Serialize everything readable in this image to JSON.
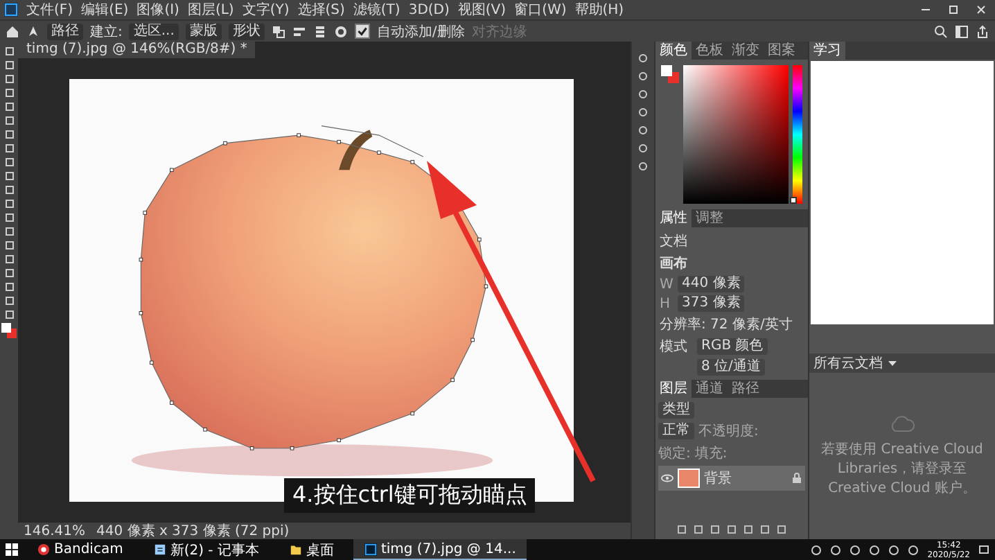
{
  "menu": [
    "文件(F)",
    "编辑(E)",
    "图像(I)",
    "图层(L)",
    "文字(Y)",
    "选择(S)",
    "滤镜(T)",
    "3D(D)",
    "视图(V)",
    "窗口(W)",
    "帮助(H)"
  ],
  "options_bar": {
    "mode": "路径",
    "make_label": "建立:",
    "make_button": "选区...",
    "mask_button": "蒙版",
    "shape_button": "形状",
    "auto_add_delete": {
      "label": "自动添加/删除",
      "checked": true
    },
    "align_edges": {
      "label": "对齐边缘",
      "disabled": true
    }
  },
  "document_tab": {
    "title": "timg (7).jpg @ 146%(RGB/8#) *"
  },
  "caption": "4.按住ctrl键可拖动瞄点",
  "color_panel": {
    "hue": {
      "level": 0
    },
    "tabs": [
      {
        "label": "颜色",
        "selected": true
      },
      {
        "label": "色板",
        "selected": false
      },
      {
        "label": "渐变",
        "selected": false
      },
      {
        "label": "图案",
        "selected": false
      }
    ]
  },
  "learn_panel": {
    "tabs": [
      {
        "label": "学习",
        "selected": true
      }
    ]
  },
  "properties_panel": {
    "tabs": [
      {
        "label": "属性",
        "selected": true
      },
      {
        "label": "调整",
        "selected": false
      }
    ],
    "section": "文档",
    "group": "画布",
    "width_label": "W",
    "width": "440 像素",
    "height_label": "H",
    "height": "373 像素",
    "resolution": "分辨率: 72 像素/英寸",
    "mode_label": "模式",
    "mode": "RGB 颜色",
    "depth": "8 位/通道"
  },
  "layers_panel": {
    "tabs": [
      {
        "label": "图层",
        "selected": true
      },
      {
        "label": "通道",
        "selected": false
      },
      {
        "label": "路径",
        "selected": false
      }
    ],
    "filter": "类型",
    "blend": "正常",
    "opacity_label": "不透明度:",
    "lock_label": "锁定:",
    "fill_label": "填充:",
    "layers": [
      {
        "name": "背景",
        "visible": true,
        "locked": true,
        "selected": true
      }
    ]
  },
  "libraries_panel": {
    "dropdown": "所有云文档",
    "message": "若要使用 Creative Cloud Libraries，请登录至 Creative Cloud 账户。"
  },
  "status_bar": {
    "zoom": "146.41%",
    "info": "440 像素 x 373 像素 (72 ppi)"
  },
  "taskbar": {
    "apps": [
      {
        "label": "Bandicam",
        "kind": "record",
        "selected": false
      },
      {
        "label": "新(2) - 记事本",
        "kind": "notepad",
        "selected": false
      },
      {
        "label": "桌面",
        "kind": "folder",
        "selected": false
      },
      {
        "label": "timg (7).jpg @ 14...",
        "kind": "ps",
        "selected": true
      }
    ],
    "time": "15:42",
    "date": "2020/5/22"
  }
}
